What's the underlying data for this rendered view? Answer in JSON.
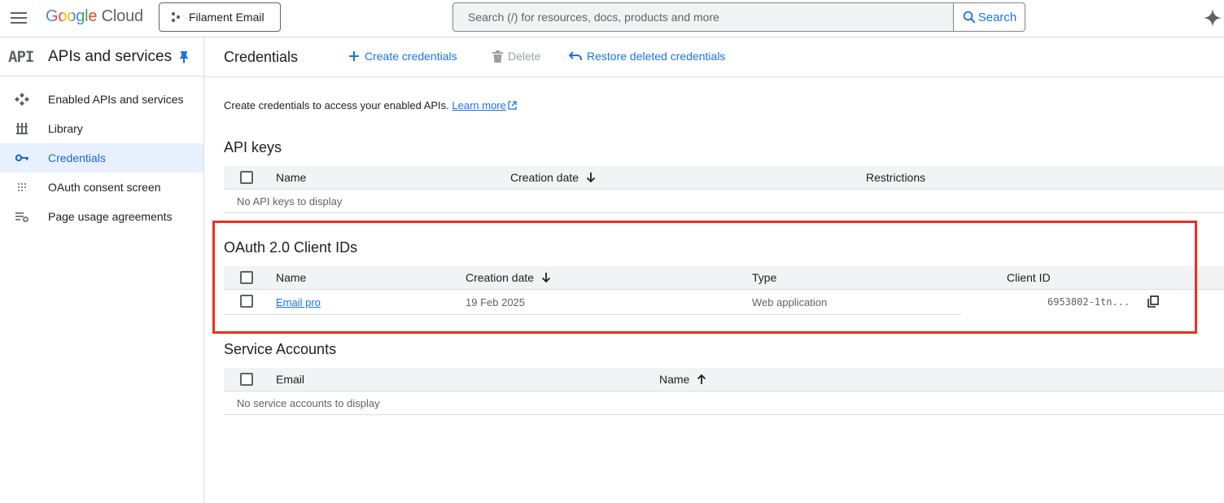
{
  "topbar": {
    "logo_google": "Google",
    "logo_cloud": "Cloud",
    "project_name": "Filament Email",
    "search_placeholder": "Search (/) for resources, docs, products and more",
    "search_button": "Search"
  },
  "sidebar": {
    "api_logo": "API",
    "title": "APIs and services",
    "items": [
      {
        "label": "Enabled APIs and services",
        "icon": "diamond-arrows-icon"
      },
      {
        "label": "Library",
        "icon": "library-icon"
      },
      {
        "label": "Credentials",
        "icon": "key-icon",
        "active": true
      },
      {
        "label": "OAuth consent screen",
        "icon": "dots-grid-icon"
      },
      {
        "label": "Page usage agreements",
        "icon": "list-settings-icon"
      }
    ]
  },
  "header": {
    "title": "Credentials",
    "create_label": "Create credentials",
    "delete_label": "Delete",
    "restore_label": "Restore deleted credentials"
  },
  "intro": {
    "text": "Create credentials to access your enabled APIs.",
    "link": "Learn more"
  },
  "api_keys": {
    "title": "API keys",
    "columns": [
      "Name",
      "Creation date",
      "Restrictions"
    ],
    "empty": "No API keys to display"
  },
  "oauth": {
    "title": "OAuth 2.0 Client IDs",
    "columns": [
      "Name",
      "Creation date",
      "Type",
      "Client ID"
    ],
    "rows": [
      {
        "name": "Email pro",
        "date": "19 Feb 2025",
        "type": "Web application",
        "client_id": "6953802-1tn..."
      }
    ]
  },
  "service_accounts": {
    "title": "Service Accounts",
    "columns": [
      "Email",
      "Name"
    ],
    "empty": "No service accounts to display"
  },
  "colors": {
    "accent": "#1a73e8",
    "highlight": "#e8321f",
    "active_bg": "#e8f0fe"
  }
}
